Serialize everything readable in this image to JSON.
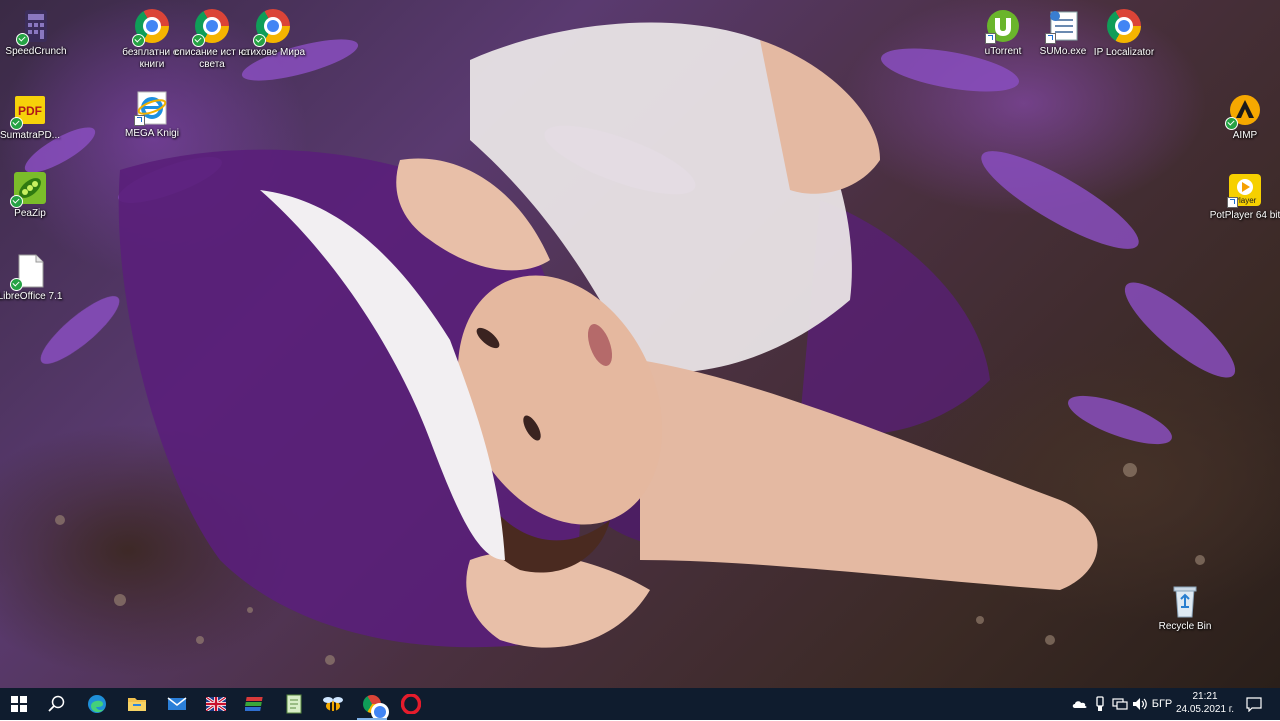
{
  "desktop": {
    "icons": [
      {
        "id": "speedcrunch",
        "label": "SpeedCrunch",
        "icon": "speedcrunch-icon"
      },
      {
        "id": "chrome-ebooks",
        "label": "безплатни е-книги",
        "icon": "chrome-icon"
      },
      {
        "id": "chrome-magazine",
        "label": "списание ист на света",
        "icon": "chrome-icon"
      },
      {
        "id": "chrome-poems",
        "label": "стихове Мира",
        "icon": "chrome-icon"
      },
      {
        "id": "sumatrapdf",
        "label": "SumatraPD...",
        "icon": "pdf-icon"
      },
      {
        "id": "mega-knigi",
        "label": "MEGA Knigi",
        "icon": "internet-explorer-icon"
      },
      {
        "id": "peazip",
        "label": "PeaZip",
        "icon": "peazip-icon"
      },
      {
        "id": "libreoffice",
        "label": "LibreOffice 7.1",
        "icon": "document-icon"
      },
      {
        "id": "utorrent",
        "label": "uTorrent",
        "icon": "utorrent-icon"
      },
      {
        "id": "sumo",
        "label": "SUMo.exe",
        "icon": "sumo-icon"
      },
      {
        "id": "ip-localizator",
        "label": "IP Localizator",
        "icon": "chrome-icon"
      },
      {
        "id": "aimp",
        "label": "AIMP",
        "icon": "aimp-icon"
      },
      {
        "id": "potplayer",
        "label": "PotPlayer 64 bit",
        "icon": "potplayer-icon"
      },
      {
        "id": "recycle-bin",
        "label": "Recycle Bin",
        "icon": "recycle-bin-icon"
      }
    ]
  },
  "taskbar": {
    "pinned": [
      {
        "id": "start",
        "icon": "windows-start-icon"
      },
      {
        "id": "search",
        "icon": "search-icon"
      },
      {
        "id": "edge",
        "icon": "edge-icon"
      },
      {
        "id": "explorer",
        "icon": "file-explorer-icon"
      },
      {
        "id": "mail",
        "icon": "mail-icon"
      },
      {
        "id": "uk-flag",
        "icon": "uk-flag-icon"
      },
      {
        "id": "stacks",
        "icon": "stacked-books-icon"
      },
      {
        "id": "notepad",
        "icon": "notepad-icon"
      },
      {
        "id": "beesoft",
        "icon": "bee-icon"
      },
      {
        "id": "chrome",
        "icon": "chrome-icon"
      },
      {
        "id": "opera",
        "icon": "opera-icon"
      }
    ],
    "tray": {
      "language": "БГР",
      "time": "21:21",
      "date": "24.05.2021 г."
    }
  }
}
